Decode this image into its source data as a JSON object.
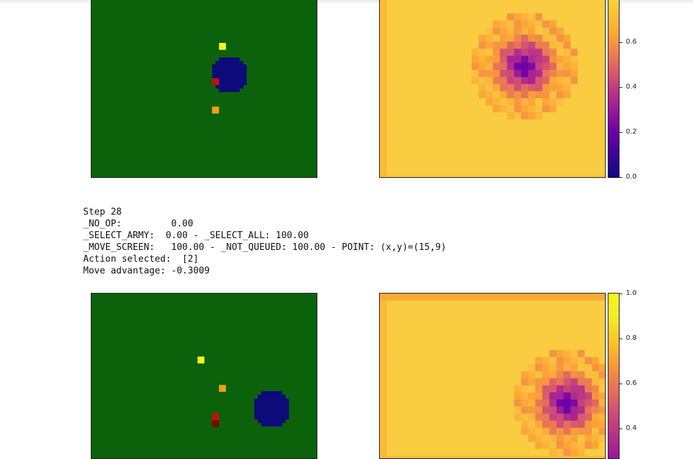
{
  "step_label": "Step 28",
  "log_lines": {
    "no_op": "_NO_OP:         0.00",
    "select_army": "_SELECT_ARMY:  0.00 - _SELECT_ALL: 100.00",
    "move_screen": "_MOVE_SCREEN:   100.00 - _NOT_QUEUED: 100.00 - POINT: (x,y)=(15,9)",
    "action_selected": "Action selected:  [2]",
    "move_advantage": "Move advantage: -0.3009"
  },
  "top_colorbar": {
    "ticks": [
      "0.6",
      "0.4",
      "0.2",
      "0.0"
    ]
  },
  "bottom_colorbar": {
    "ticks": [
      "1.0",
      "0.8",
      "0.6",
      "0.4"
    ]
  },
  "colors": {
    "board_bg": "#0b620b",
    "army_blob": "#0d0a7a",
    "marker_yellow": "#f5f518",
    "marker_orange": "#f0a010",
    "marker_red": "#c80c0c",
    "marker_darkred": "#7a0808"
  }
}
